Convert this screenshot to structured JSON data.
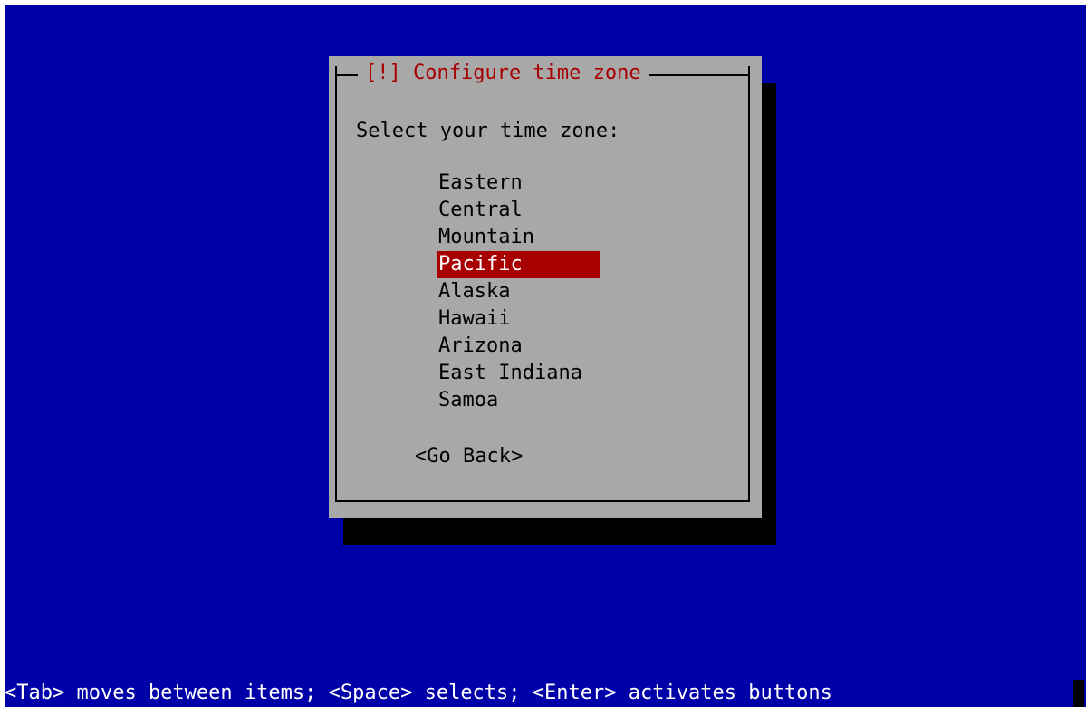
{
  "dialog": {
    "title": "[!] Configure time zone",
    "prompt": "Select your time zone:",
    "options": [
      {
        "label": "Eastern",
        "selected": false
      },
      {
        "label": "Central",
        "selected": false
      },
      {
        "label": "Mountain",
        "selected": false
      },
      {
        "label": "Pacific",
        "selected": true
      },
      {
        "label": "Alaska",
        "selected": false
      },
      {
        "label": "Hawaii",
        "selected": false
      },
      {
        "label": "Arizona",
        "selected": false
      },
      {
        "label": "East Indiana",
        "selected": false
      },
      {
        "label": "Samoa",
        "selected": false
      }
    ],
    "go_back_label": "<Go Back>"
  },
  "help_line": "<Tab> moves between items; <Space> selects; <Enter> activates buttons",
  "colors": {
    "background": "#0000a8",
    "dialog": "#a8a8a8",
    "title": "#a80000",
    "highlight": "#a80000",
    "help_text": "#ffffff"
  }
}
